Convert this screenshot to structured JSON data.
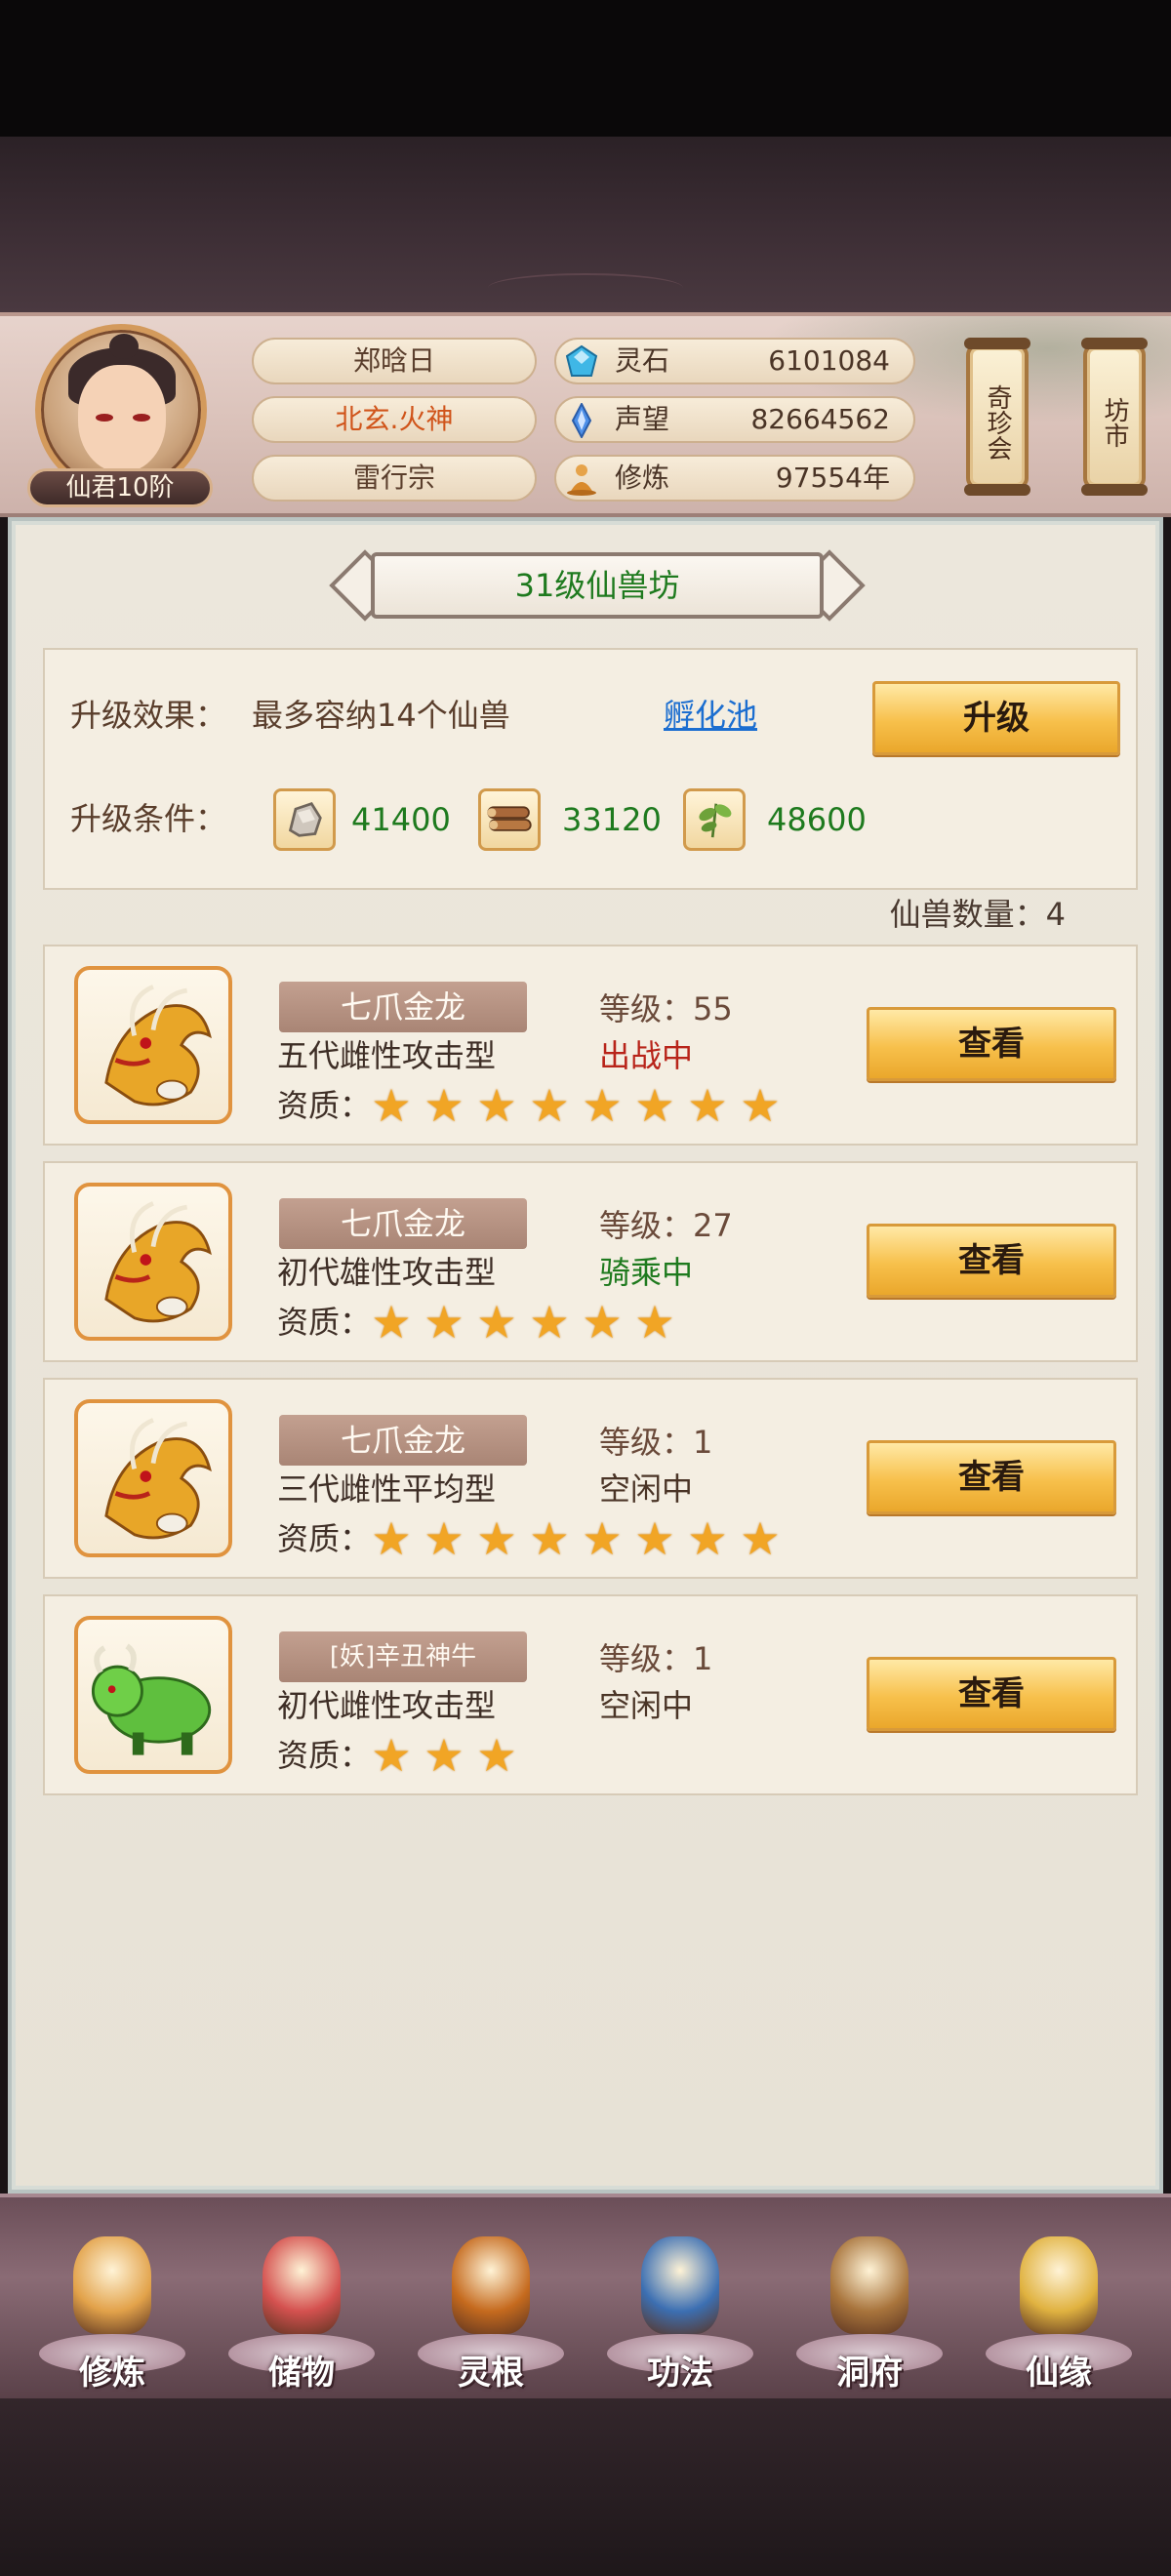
{
  "player": {
    "rank": "仙君10阶",
    "name": "郑晗日",
    "title": "北玄.火神",
    "sect": "雷行宗"
  },
  "stats": [
    {
      "icon": "spirit-stone-icon",
      "label": "灵石",
      "value": "6101084"
    },
    {
      "icon": "reputation-icon",
      "label": "声望",
      "value": "82664562"
    },
    {
      "icon": "cultivation-icon",
      "label": "修炼",
      "value": "97554年"
    }
  ],
  "side_buttons": {
    "treasure": "奇珍会",
    "market": "坊市"
  },
  "panel": {
    "title": "31级仙兽坊",
    "upgrade_effect_label": "升级效果：",
    "upgrade_effect_text": "最多容纳14个仙兽",
    "hatch_link": "孵化池",
    "upgrade_button": "升级",
    "upgrade_cond_label": "升级条件：",
    "resources": [
      {
        "icon": "ore-icon",
        "value": "41400"
      },
      {
        "icon": "wood-icon",
        "value": "33120"
      },
      {
        "icon": "herb-icon",
        "value": "48600"
      }
    ],
    "beast_count": "仙兽数量：4"
  },
  "beasts": [
    {
      "name": "七爪金龙",
      "desc": "五代雌性攻击型",
      "level": "等级：55",
      "state": "出战中",
      "state_color": "#b8241a",
      "stars": 8,
      "art": "golden-dragon"
    },
    {
      "name": "七爪金龙",
      "desc": "初代雄性攻击型",
      "level": "等级：27",
      "state": "骑乘中",
      "state_color": "#1e7a1e",
      "stars": 6,
      "art": "golden-dragon"
    },
    {
      "name": "七爪金龙",
      "desc": "三代雌性平均型",
      "level": "等级：1",
      "state": "空闲中",
      "state_color": "#4a3426",
      "stars": 8,
      "art": "golden-dragon"
    },
    {
      "name": "[妖]辛丑神牛",
      "desc": "初代雌性攻击型",
      "level": "等级：1",
      "state": "空闲中",
      "state_color": "#4a3426",
      "stars": 3,
      "art": "green-ox"
    }
  ],
  "quality_label": "资质：",
  "view_button": "查看",
  "nav": [
    {
      "label": "修炼",
      "icon": "cultivate-nav-icon",
      "color": "#e2a24a"
    },
    {
      "label": "储物",
      "icon": "storage-bag-icon",
      "color": "#d4514f"
    },
    {
      "label": "灵根",
      "icon": "spirit-root-icon",
      "color": "#c56a1e"
    },
    {
      "label": "功法",
      "icon": "skill-book-icon",
      "color": "#3c6fb2"
    },
    {
      "label": "洞府",
      "icon": "cave-house-icon",
      "color": "#a8743c"
    },
    {
      "label": "仙缘",
      "icon": "fate-gourd-icon",
      "color": "#e0b240"
    }
  ]
}
